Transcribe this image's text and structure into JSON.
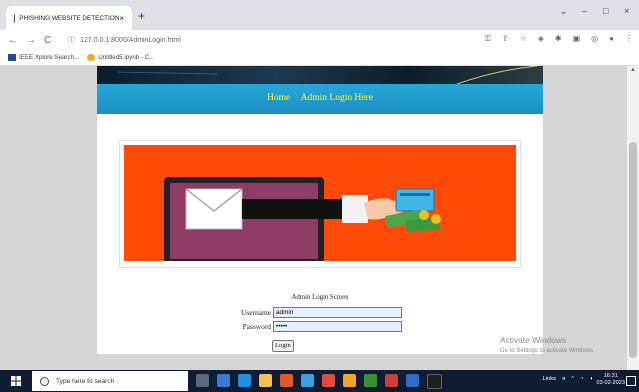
{
  "browser": {
    "tab_title": "PHISHING WEBSITE DETECTION",
    "tab_close": "×",
    "new_tab": "+",
    "url": "127.0.0.1:8000/AdminLogin.html",
    "info_label": "ⓘ",
    "nav": {
      "back": "←",
      "forward": "→",
      "reload": "C"
    },
    "window_controls": {
      "minimize": "–",
      "maximize": "□",
      "close": "×",
      "tabsearch": "⌄"
    },
    "bookmarks": [
      {
        "label": "IEEE Xplore Search...",
        "color": "#1f4e96"
      },
      {
        "label": "Untitled5.ipynb - C...",
        "color": "#f5a623"
      }
    ]
  },
  "page": {
    "nav": {
      "home": "Home",
      "admin_login": "Admin Login Here"
    },
    "login": {
      "title": "Admin Login Screen",
      "username_label": "Username",
      "username_value": "admin",
      "password_label": "Password",
      "password_value": "•••••",
      "button": "Login"
    }
  },
  "watermark": {
    "line1": "Activate Windows",
    "line2": "Go to Settings to activate Windows."
  },
  "taskbar": {
    "search_placeholder": "Type here to search",
    "links_label": "Links",
    "time": "16:31",
    "date": "03-02-2023"
  },
  "colors": {
    "nav_link": "#ffff33",
    "banner_bg": "#ff4a09",
    "nav_bg": "#1d8fc4"
  }
}
